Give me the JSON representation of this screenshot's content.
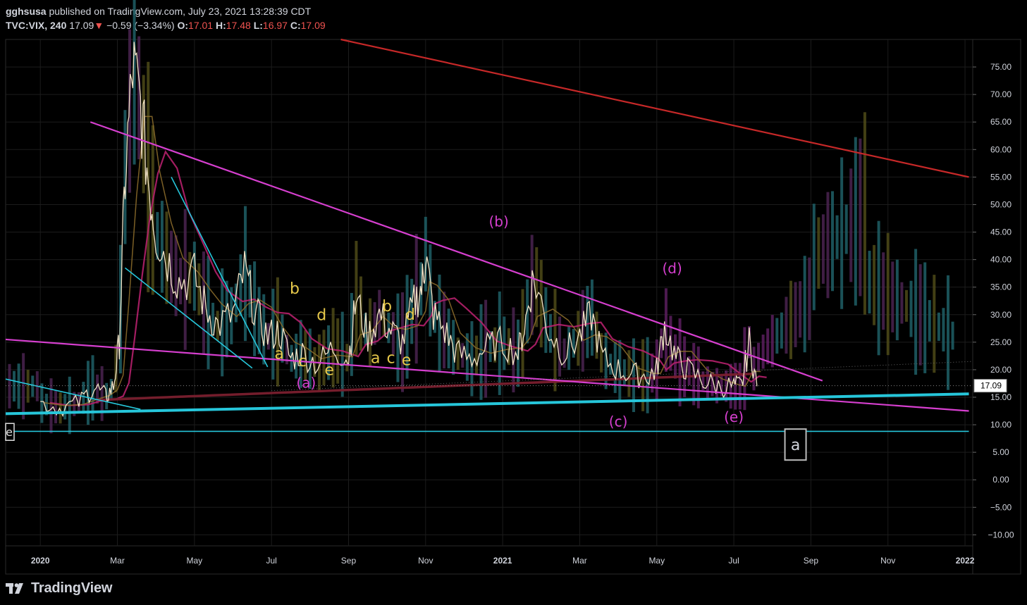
{
  "header": {
    "author": "gghsusa",
    "published_text": "published on TradingView.com, July 23, 2021 13:28:39 CDT",
    "symbol": "TVC:VIX, 240",
    "last": "17.09",
    "change": "−0.59 (−3.34%)",
    "open_label": "O:",
    "open": "17.01",
    "high_label": "H:",
    "high": "17.48",
    "low_label": "L:",
    "low": "16.97",
    "close_label": "C:",
    "close": "17.09"
  },
  "footer": {
    "brand": "TradingView",
    "logo_icon": "tradingview-logo-icon"
  },
  "colors": {
    "background": "#000000",
    "grid": "#1c1c1c",
    "magenta": "#d63fcf",
    "cyan": "#26c6da",
    "red": "#c62828",
    "yellow": "#e6c84a",
    "price_label_bg": "#ffffff"
  },
  "chart_data": {
    "type": "line",
    "y_ticks": [
      "75.00",
      "70.00",
      "65.00",
      "60.00",
      "55.00",
      "50.00",
      "45.00",
      "40.00",
      "35.00",
      "30.00",
      "25.00",
      "20.00",
      "15.00",
      "10.00",
      "5.00",
      "0.00",
      "−5.00",
      "−10.00"
    ],
    "ylim": [
      -12,
      80
    ],
    "x_ticks": [
      "2020",
      "Mar",
      "May",
      "Jul",
      "Sep",
      "Nov",
      "2021",
      "Mar",
      "May",
      "Jul",
      "Sep",
      "Nov",
      "2022"
    ],
    "x_tick_index": [
      0,
      2,
      4,
      6,
      8,
      10,
      12,
      14,
      16,
      18,
      20,
      22,
      24
    ],
    "xlim_months": [
      -0.9,
      24.2
    ],
    "last_price_label": "17.09",
    "series": [
      {
        "x": [
          0,
          0.5,
          1,
          1.4,
          1.7,
          1.9,
          2.05,
          2.2,
          2.4,
          2.6,
          2.8,
          3,
          3.3,
          3.6,
          4,
          4.3,
          4.6,
          5,
          5.3,
          5.6,
          5.9,
          6.2,
          6.5,
          6.8,
          7.2,
          7.6,
          8,
          8.2,
          8.5,
          8.8,
          9.1,
          9.4,
          9.7,
          9.9,
          10,
          10.2,
          10.5,
          10.8,
          11.2,
          11.6,
          12,
          12.4,
          12.6,
          12.8,
          13.2,
          13.6,
          14,
          14.3,
          14.6,
          15,
          15.4,
          15.8,
          16,
          16.2,
          16.5,
          16.8,
          17.2,
          17.6,
          18,
          18.2,
          18.4,
          18.6
        ],
        "values": [
          14,
          13,
          14,
          17,
          15,
          17,
          25,
          55,
          75,
          68,
          55,
          45,
          40,
          36,
          37,
          31,
          28,
          30,
          38,
          30,
          26,
          27,
          22,
          23,
          21,
          24,
          22,
          33,
          26,
          30,
          27,
          25,
          32,
          35,
          41,
          30,
          27,
          23,
          22,
          24,
          25,
          23,
          29,
          37,
          27,
          23,
          26,
          30,
          22,
          20,
          19,
          19,
          20,
          28,
          22,
          20,
          18,
          17,
          17,
          17,
          25,
          17
        ]
      }
    ],
    "annotations": [
      {
        "text": "(a)",
        "x": 6.9,
        "y": 16.7,
        "color": "magenta"
      },
      {
        "text": "(b)",
        "x": 11.9,
        "y": 46.0,
        "color": "magenta"
      },
      {
        "text": "(c)",
        "x": 15.0,
        "y": 9.7,
        "color": "magenta"
      },
      {
        "text": "(d)",
        "x": 16.4,
        "y": 37.5,
        "color": "magenta"
      },
      {
        "text": "(e)",
        "x": 18.0,
        "y": 10.5,
        "color": "magenta"
      },
      {
        "text": "b",
        "x": 6.6,
        "y": 33.8,
        "color": "yellow"
      },
      {
        "text": "a",
        "x": 6.2,
        "y": 22.0,
        "color": "yellow"
      },
      {
        "text": "c",
        "x": 6.8,
        "y": 20.6,
        "color": "yellow"
      },
      {
        "text": "d",
        "x": 7.3,
        "y": 29.0,
        "color": "yellow"
      },
      {
        "text": "e",
        "x": 7.5,
        "y": 19.0,
        "color": "yellow"
      },
      {
        "text": "b",
        "x": 9.0,
        "y": 30.6,
        "color": "yellow"
      },
      {
        "text": "d",
        "x": 9.6,
        "y": 29.1,
        "color": "yellow"
      },
      {
        "text": "a",
        "x": 8.7,
        "y": 21.2,
        "color": "yellow"
      },
      {
        "text": "c",
        "x": 9.1,
        "y": 21.2,
        "color": "yellow"
      },
      {
        "text": "e",
        "x": 9.5,
        "y": 20.8,
        "color": "yellow"
      }
    ],
    "boxed_label": {
      "text": "a",
      "x": 19.6,
      "y": 6.4
    },
    "left_edge_label": {
      "text": "e",
      "y": 8.7
    },
    "trend_lines": [
      {
        "color": "red",
        "from": [
          7.8,
          80
        ],
        "to": [
          24.1,
          55
        ]
      },
      {
        "color": "magenta",
        "from": [
          1.3,
          65
        ],
        "to": [
          20.3,
          18
        ]
      },
      {
        "color": "magenta",
        "from": [
          -0.9,
          25.5
        ],
        "to": [
          24.1,
          12.5
        ]
      },
      {
        "color": "cyan",
        "from": [
          -0.9,
          12
        ],
        "to": [
          24.1,
          15.6
        ]
      },
      {
        "color": "cyan",
        "from": [
          -0.9,
          8.8
        ],
        "to": [
          24.1,
          8.8
        ]
      },
      {
        "color": "cyan",
        "from": [
          -0.9,
          18.3
        ],
        "to": [
          2.6,
          12.8
        ]
      },
      {
        "color": "cyan",
        "from": [
          2.2,
          38.5
        ],
        "to": [
          5.5,
          20.3
        ]
      },
      {
        "color": "cyan",
        "from": [
          3.4,
          55
        ],
        "to": [
          5.9,
          20.5
        ]
      }
    ]
  }
}
